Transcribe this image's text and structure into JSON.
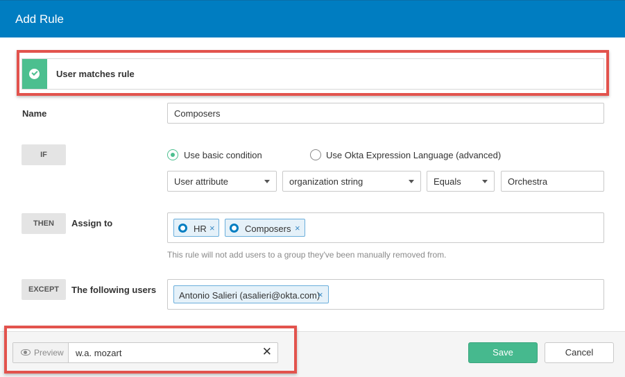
{
  "dialog": {
    "title": "Add Rule"
  },
  "banner": {
    "text": "User matches rule",
    "icon": "check-circle-icon",
    "accent": "#4cbf8f"
  },
  "name_field": {
    "label": "Name",
    "value": "Composers"
  },
  "if_section": {
    "tag": "IF",
    "options": [
      {
        "label": "Use basic condition",
        "selected": true
      },
      {
        "label": "Use Okta Expression Language (advanced)",
        "selected": false
      }
    ],
    "attribute_select": "User attribute",
    "property_select": "organization string",
    "operator_select": "Equals",
    "value": "Orchestra"
  },
  "then_section": {
    "tag": "THEN",
    "label": "Assign to",
    "groups": [
      "HR",
      "Composers"
    ],
    "help": "This rule will not add users to a group they've been manually removed from."
  },
  "except_section": {
    "tag": "EXCEPT",
    "label": "The following users",
    "users": [
      "Antonio Salieri (asalieri@okta.com)"
    ]
  },
  "footer": {
    "preview_label": "Preview",
    "preview_value": "w.a. mozart",
    "save_label": "Save",
    "cancel_label": "Cancel"
  },
  "colors": {
    "header": "#007dc1",
    "save": "#46b98e",
    "highlight": "#e2534d"
  }
}
